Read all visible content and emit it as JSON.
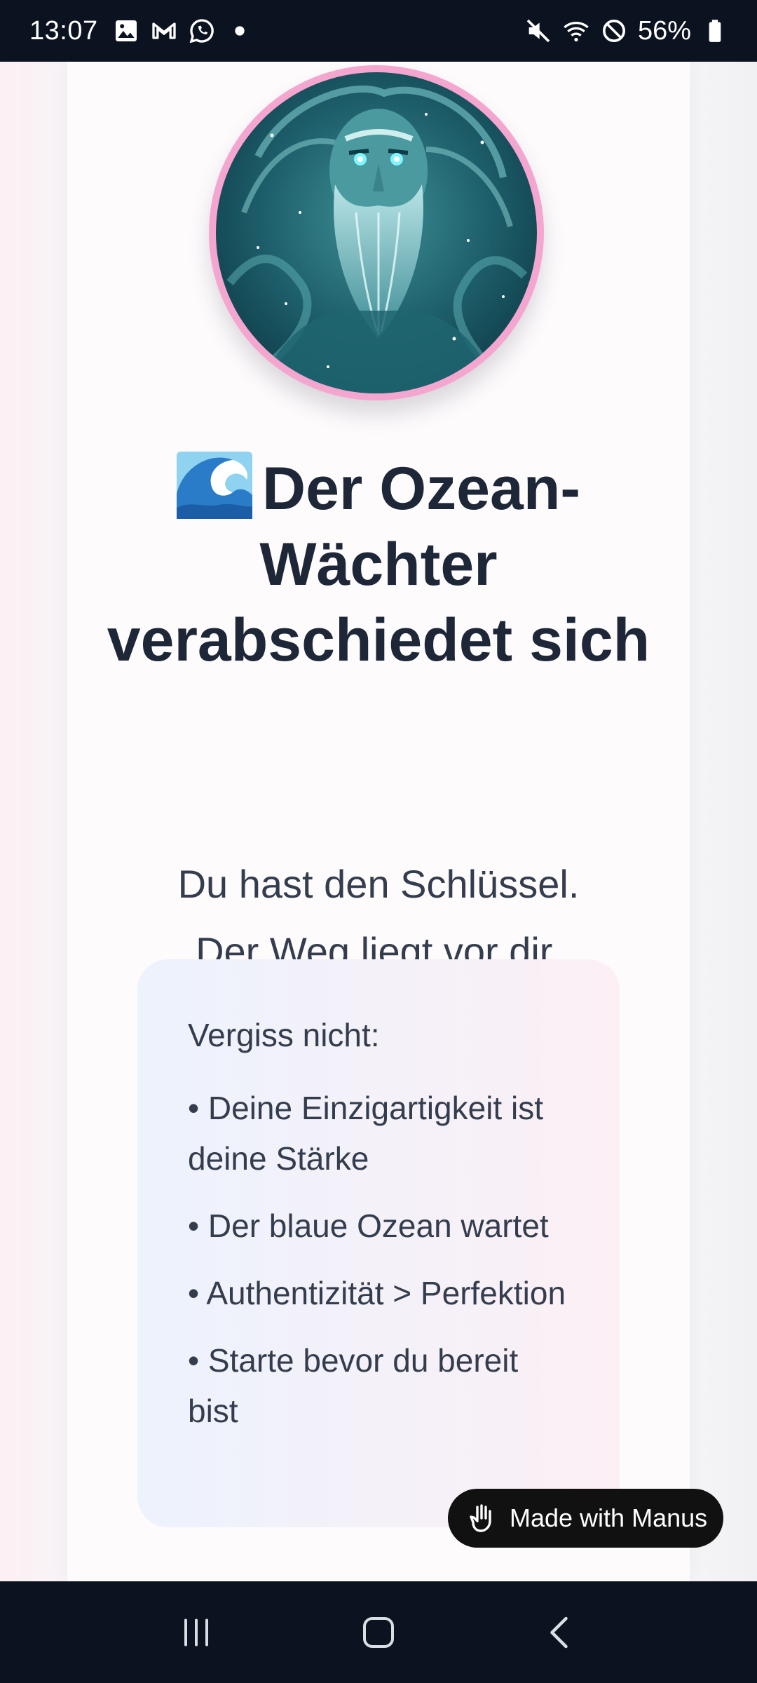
{
  "status_bar": {
    "time": "13:07",
    "battery": "56%",
    "left_icons": [
      "gallery-icon",
      "gmail-icon",
      "whatsapp-icon",
      "dot-icon"
    ],
    "right_icons": [
      "mute-icon",
      "wifi-icon",
      "do-not-disturb-icon",
      "battery-icon"
    ]
  },
  "header": {
    "title_emoji": "wave-emoji",
    "title": "Der Ozean-Wächter verabschiedet sich"
  },
  "subtitle": {
    "line1": "Du hast den Schlüssel.",
    "line2": "Der Weg liegt vor dir."
  },
  "note": {
    "heading": "Vergiss nicht:",
    "items": [
      "• Deine Einzigartigkeit ist deine Stärke",
      "• Der blaue Ozean wartet",
      "• Authentizität > Perfektion",
      "• Starte bevor du bereit bist"
    ]
  },
  "badge": {
    "label": "Made with Manus"
  },
  "colors": {
    "title": "#1e2738",
    "text": "#343d4e",
    "avatar_ring": "#f4a6cf",
    "bars": "#0b1220"
  }
}
